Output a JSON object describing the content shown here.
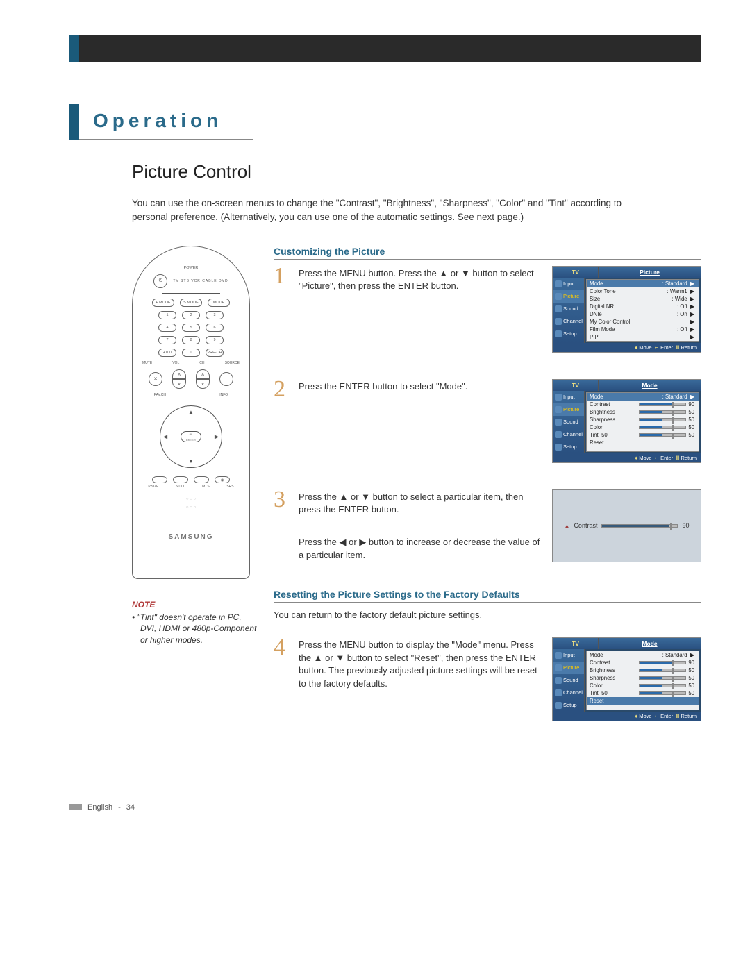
{
  "section_name": "Operation",
  "page_title": "Picture Control",
  "intro": "You can use the on-screen menus to change the \"Contrast\", \"Brightness\", \"Sharpness\", \"Color\" and \"Tint\" according to personal preference. (Alternatively, you can use one of the automatic settings. See next page.)",
  "remote": {
    "top_labels": "TV  STB  VCR  CABLE  DVD",
    "power": "POWER",
    "row2": [
      "P.MODE",
      "S.MODE",
      "MODE"
    ],
    "numpad": [
      [
        "1",
        "2",
        "3"
      ],
      [
        "4",
        "5",
        "6"
      ],
      [
        "7",
        "8",
        "9"
      ],
      [
        "+100",
        "0",
        "PRE-CH"
      ]
    ],
    "mid_labels": [
      "MUTE",
      "VOL",
      "CH",
      "SOURCE"
    ],
    "nav_labels": [
      "FAV.CH",
      "INFO"
    ],
    "enter": "ENTER",
    "enter_icon": "↵",
    "nav_arrows": [
      "▲",
      "▼",
      "◀",
      "▶"
    ],
    "bottom_row": [
      "P.SIZE",
      "STILL",
      "MTS",
      "SRS"
    ],
    "logo": "SAMSUNG"
  },
  "note": {
    "title": "NOTE",
    "text": "\"Tint\" doesn't operate in PC, DVI, HDMI or 480p-Component or higher modes."
  },
  "headings": {
    "customize": "Customizing the Picture",
    "reset": "Resetting the Picture Settings to the Factory Defaults"
  },
  "reset_intro": "You can return to the factory default picture settings.",
  "steps": {
    "s1": "Press the MENU button. Press the ▲ or ▼ button to select \"Picture\", then press the ENTER button.",
    "s2": "Press the ENTER button to select \"Mode\".",
    "s3a": "Press the ▲ or ▼ button to select a particular item, then press the ENTER button.",
    "s3b": "Press the ◀ or ▶ button to increase or decrease the value of a particular item.",
    "s4": "Press the MENU button to display the \"Mode\" menu. Press the ▲ or ▼ button to select \"Reset\", then press the ENTER button. The previously adjusted picture settings will be reset to the factory defaults."
  },
  "osd": {
    "tv": "TV",
    "picture_hdr": "Picture",
    "mode_hdr": "Mode",
    "tabs": [
      "Input",
      "Picture",
      "Sound",
      "Channel",
      "Setup"
    ],
    "picture_items": [
      {
        "l": "Mode",
        "r": ": Standard"
      },
      {
        "l": "Color Tone",
        "r": ": Warm1"
      },
      {
        "l": "Size",
        "r": ": Wide"
      },
      {
        "l": "Digital NR",
        "r": ": Off"
      },
      {
        "l": "DNIe",
        "r": ": On"
      },
      {
        "l": "My Color Control",
        "r": ""
      },
      {
        "l": "Film Mode",
        "r": ": Off"
      },
      {
        "l": "PIP",
        "r": ""
      }
    ],
    "mode_items": [
      {
        "l": "Mode",
        "r": ": Standard",
        "type": "val"
      },
      {
        "l": "Contrast",
        "r": "90",
        "type": "slider"
      },
      {
        "l": "Brightness",
        "r": "50",
        "type": "slider"
      },
      {
        "l": "Sharpness",
        "r": "50",
        "type": "slider"
      },
      {
        "l": "Color",
        "r": "50",
        "type": "slider"
      },
      {
        "l": "Tint",
        "r": "50",
        "type": "slider",
        "pre": "50"
      },
      {
        "l": "Reset",
        "r": "",
        "type": "val"
      }
    ],
    "adj": {
      "label": "Contrast",
      "value": "90"
    },
    "hint_move": "Move",
    "hint_enter": "Enter",
    "hint_return": "Return"
  },
  "footer": {
    "l": "English",
    "p": "34"
  }
}
